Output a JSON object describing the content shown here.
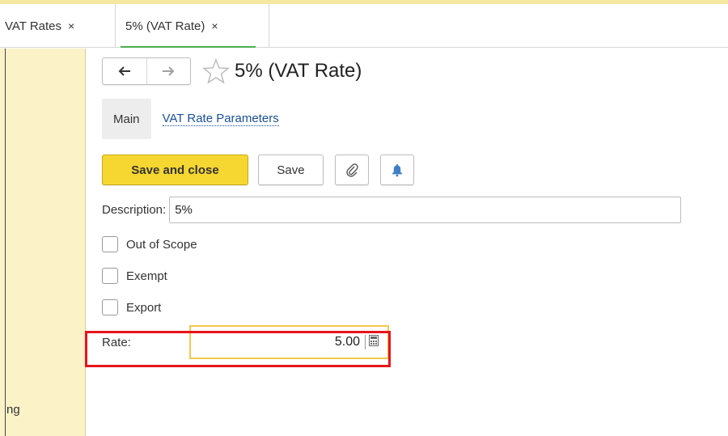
{
  "tabs": [
    {
      "label": "VAT Rates",
      "close": "×"
    },
    {
      "label": "5% (VAT Rate)",
      "close": "×"
    }
  ],
  "left_panel": {
    "partial_text": "ng"
  },
  "nav": {
    "back_icon": "left-arrow-icon",
    "forward_icon": "right-arrow-icon",
    "favorite_icon": "star-outline-icon"
  },
  "form": {
    "title": "5% (VAT Rate)"
  },
  "section_tabs": {
    "main": "Main",
    "parameters": "VAT Rate Parameters"
  },
  "toolbar": {
    "save_close": "Save and close",
    "save": "Save",
    "attach_icon": "paperclip-icon",
    "reminder_icon": "bell-icon"
  },
  "fields": {
    "description_label": "Description:",
    "description_value": "5%",
    "out_of_scope": "Out of Scope",
    "exempt": "Exempt",
    "export": "Export",
    "rate_label": "Rate:",
    "rate_value": "5.00",
    "calc_icon": "calculator-icon"
  },
  "colors": {
    "primary_button": "#f6d631",
    "highlight": "#e8141a",
    "active_field_border": "#f2c84b",
    "link": "#1a4f9c",
    "side_panel": "#fbf3c7",
    "active_tab_underline": "#4caf50"
  }
}
